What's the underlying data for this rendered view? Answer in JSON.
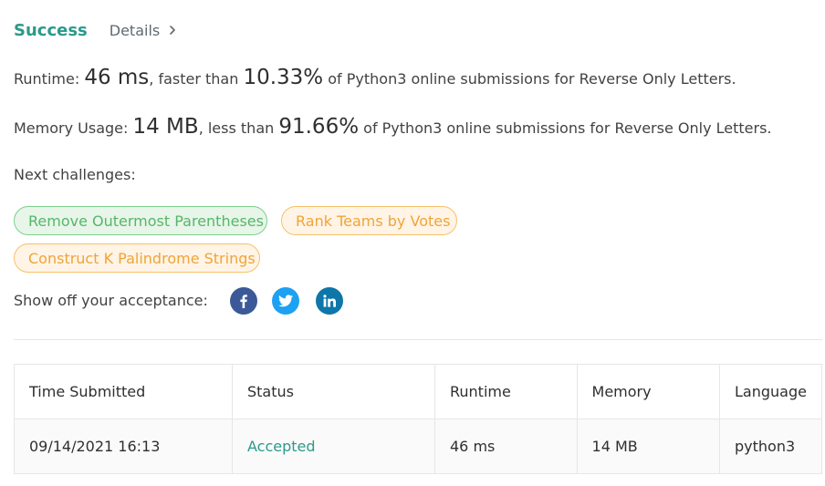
{
  "header": {
    "status": "Success",
    "details_label": "Details"
  },
  "runtime": {
    "prefix": "Runtime: ",
    "value": "46 ms",
    "middle": ", faster than ",
    "percent": "10.33%",
    "suffix": " of Python3 online submissions for Reverse Only Letters."
  },
  "memory": {
    "prefix": "Memory Usage: ",
    "value": "14 MB",
    "middle": ", less than ",
    "percent": "91.66%",
    "suffix": " of Python3 online submissions for Reverse Only Letters."
  },
  "next_challenges": {
    "label": "Next challenges:",
    "items": [
      {
        "label": "Remove Outermost Parentheses",
        "difficulty_color": "#55b769"
      },
      {
        "label": "Rank Teams by Votes",
        "difficulty_color": "#f0a43a"
      },
      {
        "label": "Construct K Palindrome Strings",
        "difficulty_color": "#f0a43a"
      }
    ]
  },
  "share": {
    "label": "Show off your acceptance:",
    "icons": [
      "facebook-icon",
      "twitter-icon",
      "linkedin-icon"
    ]
  },
  "table": {
    "headers": [
      "Time Submitted",
      "Status",
      "Runtime",
      "Memory",
      "Language"
    ],
    "rows": [
      {
        "time": "09/14/2021 16:13",
        "status": "Accepted",
        "runtime": "46 ms",
        "memory": "14 MB",
        "language": "python3"
      }
    ]
  },
  "colors": {
    "accent": "#2b9a8a",
    "easy": "#55b769",
    "medium": "#f0a43a",
    "facebook": "#3b5998",
    "twitter": "#1da1f2",
    "linkedin": "#0e76a8"
  }
}
